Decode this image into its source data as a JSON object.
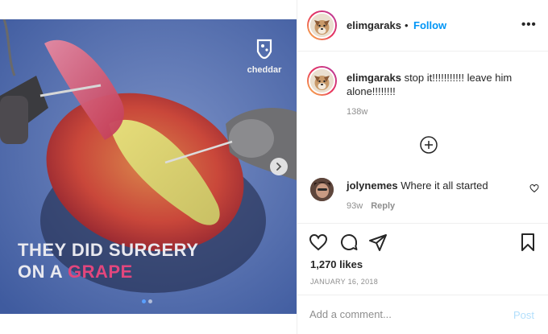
{
  "media": {
    "overlay_line1": "THEY DID SURGERY",
    "overlay_line2_prefix": "ON A ",
    "overlay_line2_highlight": "GRAPE",
    "watermark": "cheddar",
    "next_icon": "chevron-right-icon",
    "carousel_dots": 2,
    "active_dot": 1
  },
  "header": {
    "username": "elimgaraks",
    "separator": "•",
    "follow_label": "Follow",
    "more_icon": "more-options-icon",
    "more_label": "•••"
  },
  "caption": {
    "username": "elimgaraks",
    "text": "stop it!!!!!!!!!!! leave him alone!!!!!!!!",
    "time": "138w"
  },
  "load_more_icon": "plus-circle-icon",
  "comments": [
    {
      "username": "jolynemes",
      "text": "Where it all started",
      "time": "93w",
      "reply_label": "Reply"
    }
  ],
  "actions": {
    "like_icon": "heart-icon",
    "comment_icon": "comment-icon",
    "share_icon": "share-icon",
    "save_icon": "bookmark-icon",
    "likes": "1,270 likes",
    "date": "JANUARY 16, 2018"
  },
  "add_comment": {
    "placeholder": "Add a comment...",
    "post_label": "Post"
  },
  "colors": {
    "accent": "#0095f6",
    "highlight": "#e2467d",
    "muted": "#8e8e8e"
  }
}
